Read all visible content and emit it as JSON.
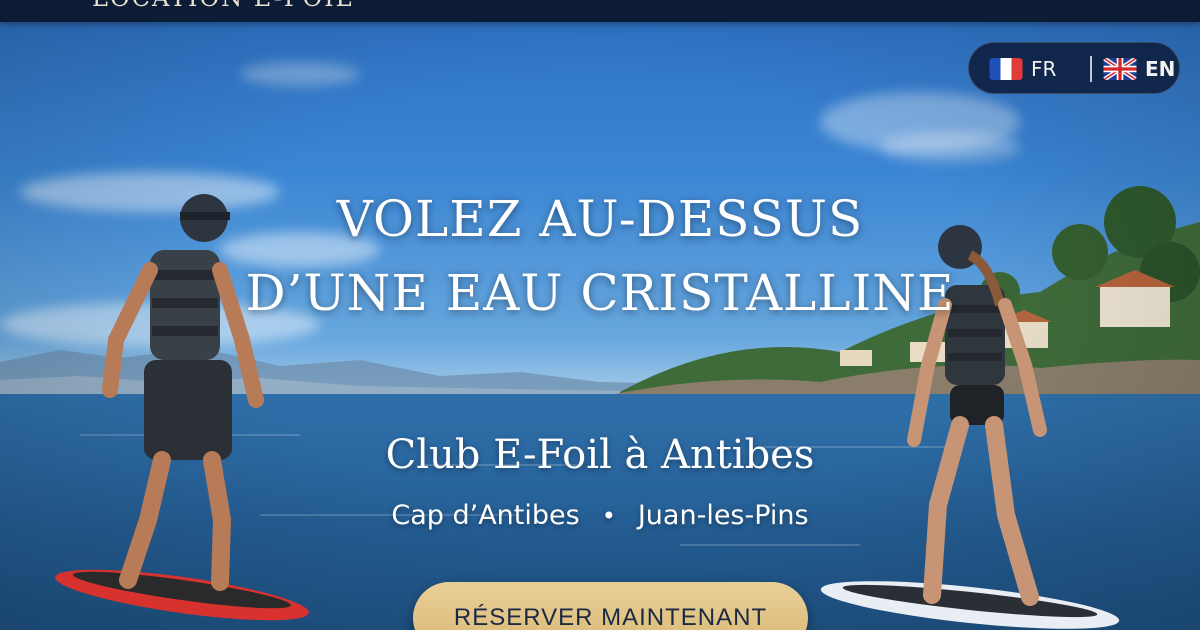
{
  "header": {
    "brand": "LOCATION E-FOIL"
  },
  "language_switcher": {
    "options": [
      {
        "code": "FR",
        "flag": "french-flag-icon"
      },
      {
        "code": "EN",
        "flag": "uk-flag-icon"
      }
    ],
    "active": "EN"
  },
  "hero": {
    "headline_line1": "VOLEZ AU-DESSUS",
    "headline_line2": "D’UNE EAU CRISTALLINE",
    "subtitle": "Club E-Foil à Antibes",
    "location_1": "Cap d’Antibes",
    "separator": "•",
    "location_2": "Juan-les-Pins",
    "cta_label": "RÉSERVER MAINTENANT"
  },
  "colors": {
    "navy": "#0c1b36",
    "cta_gold": "#e2c487",
    "sky": "#3b86d4",
    "sea": "#245d93"
  }
}
